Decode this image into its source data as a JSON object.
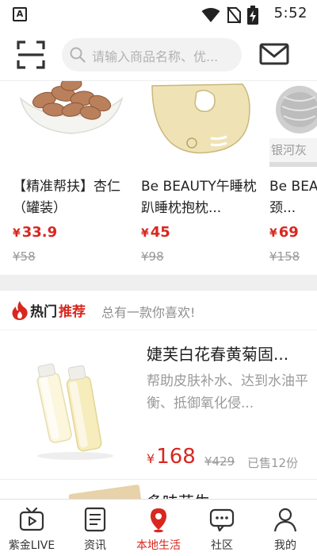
{
  "status_bar": {
    "app_icon_letter": "A",
    "time": "5:52",
    "icons": [
      "wifi-icon",
      "no-sim-icon",
      "battery-charging-icon"
    ]
  },
  "header": {
    "search_placeholder": "请输入商品名称、优...",
    "icons": [
      "scan-icon",
      "mail-icon"
    ]
  },
  "carousel": {
    "items": [
      {
        "title": "【精准帮扶】杏仁（罐装）",
        "price": "33.9",
        "original_price": "¥58",
        "currency": "¥"
      },
      {
        "title": "Be BEAUTY午睡枕趴睡枕抱枕...",
        "price": "45",
        "original_price": "¥98",
        "currency": "¥"
      },
      {
        "title": "Be BEAUTY U型护颈...",
        "price": "69",
        "original_price": "¥158",
        "currency": "¥",
        "image_label": "银河灰"
      }
    ]
  },
  "hot": {
    "title_part1": "热门",
    "title_part2": "推荐",
    "subtitle": "总有一款你喜欢!"
  },
  "recommended": {
    "items": [
      {
        "title": "婕芙白花春黄菊固...",
        "description": "帮助皮肤补水、达到水油平衡、抵御氧化侵...",
        "currency": "¥",
        "price": "168",
        "original_price": "¥429",
        "sold": "已售12份"
      },
      {
        "title": "多味花生"
      }
    ]
  },
  "bottom_nav": {
    "items": [
      {
        "label": "紫金LIVE",
        "icon": "tv-play-icon",
        "active": false
      },
      {
        "label": "资讯",
        "icon": "news-list-icon",
        "active": false
      },
      {
        "label": "本地生活",
        "icon": "location-pin-icon",
        "active": true
      },
      {
        "label": "社区",
        "icon": "chat-bubble-icon",
        "active": false
      },
      {
        "label": "我的",
        "icon": "user-icon",
        "active": false
      }
    ]
  },
  "colors": {
    "accent": "#d9271f",
    "text": "#222222",
    "muted": "#9a9a9a",
    "separator": "#efefef"
  }
}
